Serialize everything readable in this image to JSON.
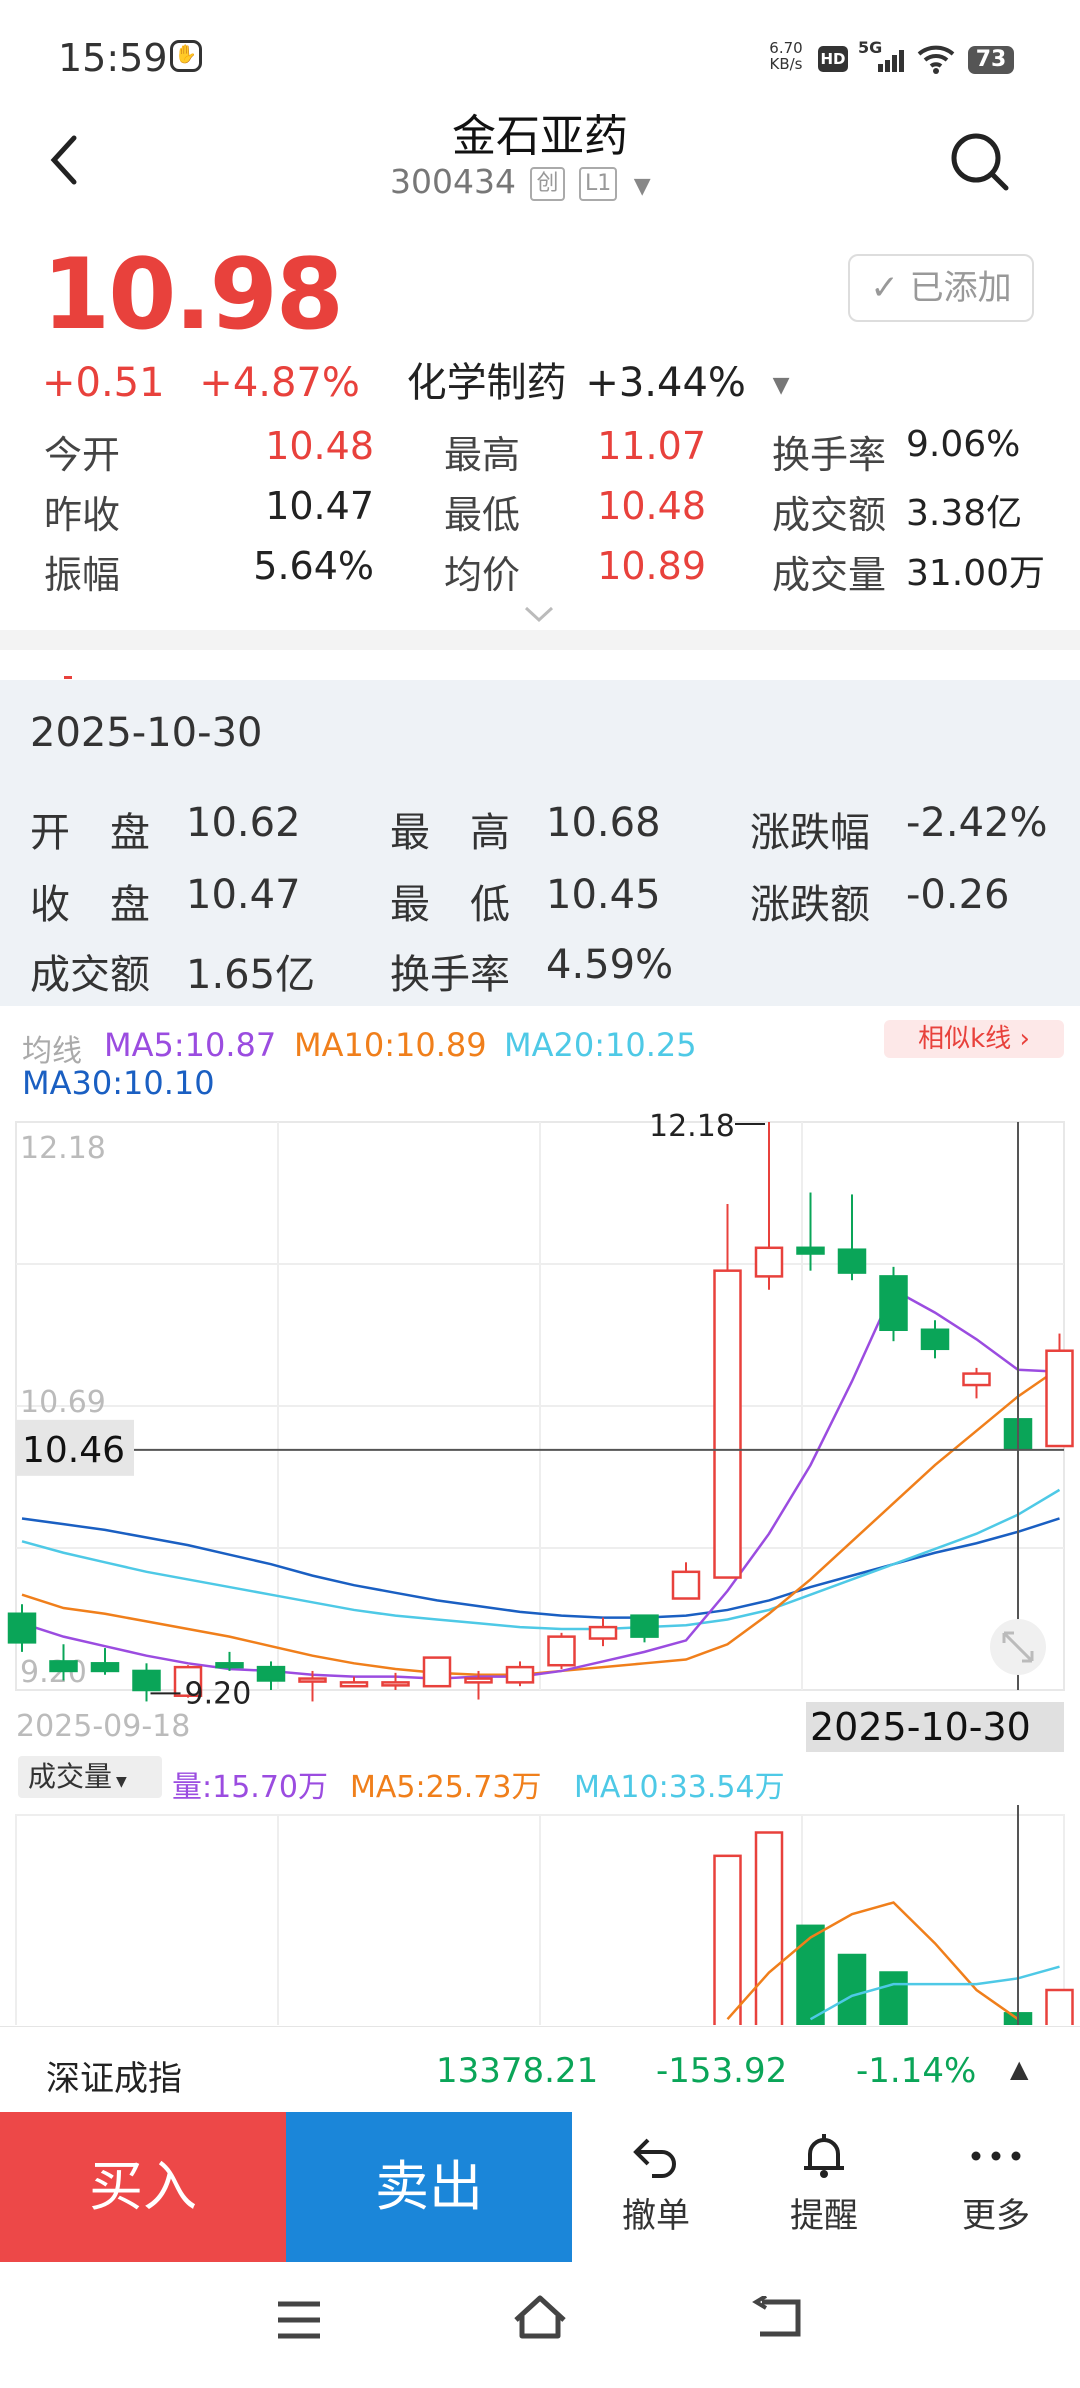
{
  "status": {
    "time": "15:59",
    "net_speed": "6.70",
    "net_unit": "KB/s",
    "hd": "HD",
    "signal": "5G",
    "battery": "73"
  },
  "header": {
    "title": "金石亚药",
    "code": "300434",
    "tag1": "创",
    "tag2": "L1"
  },
  "quote": {
    "price": "10.98",
    "change": "+0.51",
    "change_pct": "+4.87%",
    "sector": "化学制药",
    "sector_pct": "+3.44%",
    "added_label": "已添加",
    "stats": [
      {
        "label": "今开",
        "value": "10.48",
        "color": "red"
      },
      {
        "label": "最高",
        "value": "11.07",
        "color": "red"
      },
      {
        "label": "换手率",
        "value": "9.06%",
        "color": "dark"
      },
      {
        "label": "昨收",
        "value": "10.47",
        "color": "dark"
      },
      {
        "label": "最低",
        "value": "10.48",
        "color": "red"
      },
      {
        "label": "成交额",
        "value": "3.38亿",
        "color": "dark"
      },
      {
        "label": "振幅",
        "value": "5.64%",
        "color": "dark"
      },
      {
        "label": "均价",
        "value": "10.89",
        "color": "red"
      },
      {
        "label": "成交量",
        "value": "31.00万",
        "color": "dark"
      }
    ]
  },
  "ohlc": {
    "date": "2025-10-30",
    "open_label": "开　盘",
    "open": "10.62",
    "high_label": "最　高",
    "high": "10.68",
    "chgpct_label": "涨跌幅",
    "chgpct": "-2.42%",
    "close_label": "收　盘",
    "close": "10.47",
    "low_label": "最　低",
    "low": "10.45",
    "chg_label": "涨跌额",
    "chg": "-0.26",
    "amount_label": "成交额",
    "amount": "1.65亿",
    "turnover_label": "换手率",
    "turnover": "4.59%"
  },
  "ma": {
    "label": "均线",
    "ma5": "MA5:10.87",
    "ma10": "MA10:10.89",
    "ma20": "MA20:10.25",
    "ma30": "MA30:10.10",
    "similar": "相似k线"
  },
  "colors": {
    "up": "#e8413c",
    "down": "#0aa558",
    "ma5": "#9b4ce0",
    "ma10": "#f07f1b",
    "ma20": "#4ec9e6",
    "ma30": "#1a5fc2",
    "sell": "#1b86d9",
    "buy": "#ed4848"
  },
  "axis": {
    "top": "12.18",
    "mid": "10.69",
    "bottom": "9.20",
    "cursor_price": "10.46",
    "high_mark": "12.18",
    "low_mark": "9.20",
    "start_date": "2025-09-18",
    "cursor_date": "2025-10-30"
  },
  "chart_data": {
    "type": "candlestick",
    "y_range": [
      9.2,
      12.18
    ],
    "candles": [
      {
        "o": 9.6,
        "c": 9.45,
        "h": 9.65,
        "l": 9.4
      },
      {
        "o": 9.35,
        "c": 9.3,
        "h": 9.44,
        "l": 9.25
      },
      {
        "o": 9.34,
        "c": 9.3,
        "h": 9.42,
        "l": 9.28
      },
      {
        "o": 9.3,
        "c": 9.2,
        "h": 9.34,
        "l": 9.14
      },
      {
        "o": 9.17,
        "c": 9.32,
        "h": 9.33,
        "l": 9.16
      },
      {
        "o": 9.34,
        "c": 9.32,
        "h": 9.4,
        "l": 9.3
      },
      {
        "o": 9.32,
        "c": 9.25,
        "h": 9.35,
        "l": 9.2
      },
      {
        "o": 9.26,
        "c": 9.26,
        "h": 9.3,
        "l": 9.14
      },
      {
        "o": 9.22,
        "c": 9.24,
        "h": 9.27,
        "l": 9.22
      },
      {
        "o": 9.24,
        "c": 9.24,
        "h": 9.29,
        "l": 9.2
      },
      {
        "o": 9.22,
        "c": 9.37,
        "h": 9.37,
        "l": 9.22
      },
      {
        "o": 9.24,
        "c": 9.26,
        "h": 9.3,
        "l": 9.15
      },
      {
        "o": 9.24,
        "c": 9.32,
        "h": 9.35,
        "l": 9.22
      },
      {
        "o": 9.33,
        "c": 9.48,
        "h": 9.5,
        "l": 9.31
      },
      {
        "o": 9.47,
        "c": 9.53,
        "h": 9.58,
        "l": 9.43
      },
      {
        "o": 9.59,
        "c": 9.48,
        "h": 9.59,
        "l": 9.45
      },
      {
        "o": 9.68,
        "c": 9.82,
        "h": 9.87,
        "l": 9.68
      },
      {
        "o": 9.79,
        "c": 11.4,
        "h": 11.75,
        "l": 9.79
      },
      {
        "o": 11.37,
        "c": 11.52,
        "h": 12.18,
        "l": 11.3
      },
      {
        "o": 11.52,
        "c": 11.49,
        "h": 11.81,
        "l": 11.4
      },
      {
        "o": 11.51,
        "c": 11.39,
        "h": 11.8,
        "l": 11.35
      },
      {
        "o": 11.37,
        "c": 11.09,
        "h": 11.42,
        "l": 11.03
      },
      {
        "o": 11.09,
        "c": 10.99,
        "h": 11.14,
        "l": 10.94
      },
      {
        "o": 10.8,
        "c": 10.86,
        "h": 10.89,
        "l": 10.73
      },
      {
        "o": 10.62,
        "c": 10.47,
        "h": 10.68,
        "l": 10.45
      },
      {
        "o": 10.48,
        "c": 10.98,
        "h": 11.07,
        "l": 10.48
      }
    ],
    "ma5": [
      9.55,
      9.48,
      9.43,
      9.38,
      9.34,
      9.31,
      9.3,
      9.28,
      9.27,
      9.27,
      9.26,
      9.27,
      9.27,
      9.3,
      9.35,
      9.4,
      9.46,
      9.72,
      10.02,
      10.38,
      10.82,
      11.3,
      11.18,
      11.04,
      10.88,
      10.87
    ],
    "ma10": [
      9.7,
      9.63,
      9.6,
      9.56,
      9.52,
      9.48,
      9.43,
      9.38,
      9.34,
      9.31,
      9.29,
      9.28,
      9.28,
      9.3,
      9.32,
      9.34,
      9.36,
      9.44,
      9.6,
      9.78,
      9.98,
      10.18,
      10.38,
      10.56,
      10.74,
      10.89
    ],
    "ma20": [
      9.98,
      9.92,
      9.87,
      9.82,
      9.78,
      9.74,
      9.7,
      9.66,
      9.62,
      9.59,
      9.57,
      9.55,
      9.53,
      9.52,
      9.52,
      9.53,
      9.54,
      9.57,
      9.62,
      9.7,
      9.78,
      9.86,
      9.94,
      10.02,
      10.12,
      10.25
    ],
    "ma30": [
      10.1,
      10.07,
      10.04,
      10.0,
      9.96,
      9.91,
      9.86,
      9.8,
      9.75,
      9.71,
      9.67,
      9.64,
      9.61,
      9.59,
      9.58,
      9.58,
      9.59,
      9.62,
      9.67,
      9.74,
      9.8,
      9.86,
      9.92,
      9.97,
      10.03,
      10.1
    ]
  },
  "volume": {
    "label": "成交量",
    "q": "量:15.70万",
    "ma5": "MA5:25.73万",
    "ma10": "MA10:33.54万",
    "bars": [
      {
        "i": 17,
        "v": 29,
        "up": true
      },
      {
        "i": 18,
        "v": 33,
        "up": true
      },
      {
        "i": 19,
        "v": 17,
        "up": false
      },
      {
        "i": 20,
        "v": 12,
        "up": false
      },
      {
        "i": 21,
        "v": 9,
        "up": false
      },
      {
        "i": 24,
        "v": 2,
        "up": false
      },
      {
        "i": 25,
        "v": 6,
        "up": true
      }
    ],
    "ma5_line": [
      [
        17,
        1
      ],
      [
        18,
        9
      ],
      [
        19,
        15
      ],
      [
        20,
        19
      ],
      [
        21,
        21
      ],
      [
        22,
        14
      ],
      [
        23,
        6
      ],
      [
        24,
        1
      ]
    ],
    "ma10_line": [
      [
        19,
        1
      ],
      [
        20,
        5
      ],
      [
        21,
        7
      ],
      [
        22,
        7
      ],
      [
        23,
        7
      ],
      [
        24,
        8
      ],
      [
        25,
        10
      ]
    ],
    "v_max": 36
  },
  "index": {
    "name": "深证成指",
    "value": "13378.21",
    "change": "-153.92",
    "pct": "-1.14%"
  },
  "actions": {
    "buy": "买入",
    "sell": "卖出",
    "cancel": "撤单",
    "alert": "提醒",
    "more": "更多"
  }
}
